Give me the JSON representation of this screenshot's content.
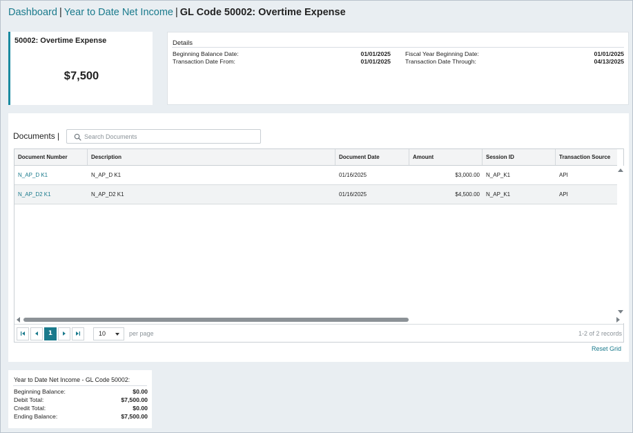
{
  "breadcrumb": {
    "items": [
      "Dashboard",
      "Year to Date Net Income"
    ],
    "separator": "|",
    "current": "GL Code 50002: Overtime Expense"
  },
  "summary": {
    "title": "50002: Overtime Expense",
    "value": "$7,500"
  },
  "details": {
    "title": "Details",
    "left": [
      {
        "label": "Beginning Balance Date:",
        "value": "01/01/2025"
      },
      {
        "label": "Transaction Date From:",
        "value": "01/01/2025"
      }
    ],
    "right": [
      {
        "label": "Fiscal Year Beginning Date:",
        "value": "01/01/2025"
      },
      {
        "label": "Transaction Date Through:",
        "value": "04/13/2025"
      }
    ]
  },
  "documents": {
    "label": "Documents |",
    "search_placeholder": "Search Documents",
    "columns": [
      "Document Number",
      "Description",
      "Document Date",
      "Amount",
      "Session ID",
      "Transaction Source"
    ],
    "rows": [
      {
        "document_number": "N_AP_D K1",
        "description": "N_AP_D K1",
        "document_date": "01/16/2025",
        "amount": "$3,000.00",
        "session_id": "N_AP_K1",
        "transaction_source": "API"
      },
      {
        "document_number": "N_AP_D2 K1",
        "description": "N_AP_D2 K1",
        "document_date": "01/16/2025",
        "amount": "$4,500.00",
        "session_id": "N_AP_K1",
        "transaction_source": "API"
      }
    ],
    "pager": {
      "current_page": "1",
      "page_size": "10",
      "per_page_label": "per page",
      "records_text": "1-2 of 2 records"
    },
    "reset_label": "Reset Grid"
  },
  "ytd": {
    "title": "Year to Date Net Income - GL Code 50002:",
    "rows": [
      {
        "label": "Beginning Balance:",
        "value": "$0.00"
      },
      {
        "label": "Debit Total:",
        "value": "$7,500.00"
      },
      {
        "label": "Credit Total:",
        "value": "$0.00"
      },
      {
        "label": "Ending Balance:",
        "value": "$7,500.00"
      }
    ]
  },
  "colors": {
    "accent": "#1a7a8c",
    "page_bg": "#e9eef2"
  }
}
